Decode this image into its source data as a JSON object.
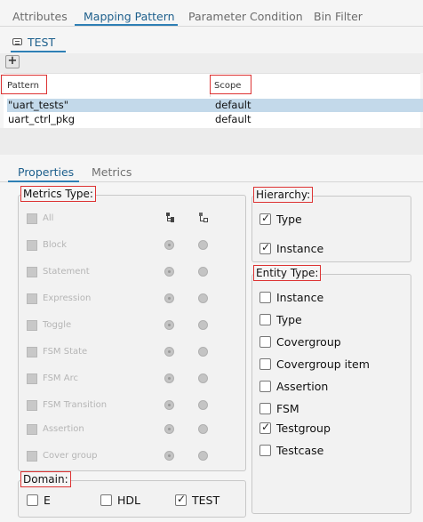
{
  "top_tabs": [
    {
      "label": "Attributes"
    },
    {
      "label": "Mapping Pattern"
    },
    {
      "label": "Parameter Condition"
    },
    {
      "label": "Bin Filter"
    }
  ],
  "active_top_tab": "Mapping Pattern",
  "subtab": {
    "label": "TEST"
  },
  "toolbar": {
    "add_label": "+"
  },
  "table": {
    "columns": [
      "Pattern",
      "Scope"
    ],
    "rows": [
      {
        "pattern": "\"uart_tests\"",
        "scope": "default",
        "selected": true
      },
      {
        "pattern": "uart_ctrl_pkg",
        "scope": "default",
        "selected": false
      }
    ]
  },
  "props_tabs": [
    {
      "label": "Properties"
    },
    {
      "label": "Metrics"
    }
  ],
  "metrics_type": {
    "legend": "Metrics Type:",
    "items": [
      "All",
      "Block",
      "Statement",
      "Expression",
      "Toggle",
      "FSM State",
      "FSM Arc",
      "FSM Transition",
      "Assertion",
      "Cover group"
    ]
  },
  "hierarchy": {
    "legend": "Hierarchy:",
    "items": [
      {
        "label": "Type",
        "checked": true
      },
      {
        "label": "Instance",
        "checked": true
      }
    ]
  },
  "entity_type": {
    "legend": "Entity Type:",
    "items": [
      {
        "label": "Instance",
        "checked": false
      },
      {
        "label": "Type",
        "checked": false
      },
      {
        "label": "Covergroup",
        "checked": false
      },
      {
        "label": "Covergroup item",
        "checked": false
      },
      {
        "label": "Assertion",
        "checked": false
      },
      {
        "label": "FSM",
        "checked": false
      },
      {
        "label": "Testgroup",
        "checked": true
      },
      {
        "label": "Testcase",
        "checked": false
      }
    ]
  },
  "domain": {
    "legend": "Domain:",
    "items": [
      {
        "label": "E",
        "checked": false
      },
      {
        "label": "HDL",
        "checked": false
      },
      {
        "label": "TEST",
        "checked": true
      }
    ]
  },
  "colors": {
    "accent": "#2e7fb5",
    "highlight_box": "#dd3333",
    "selected_row": "#c3d9ea"
  }
}
